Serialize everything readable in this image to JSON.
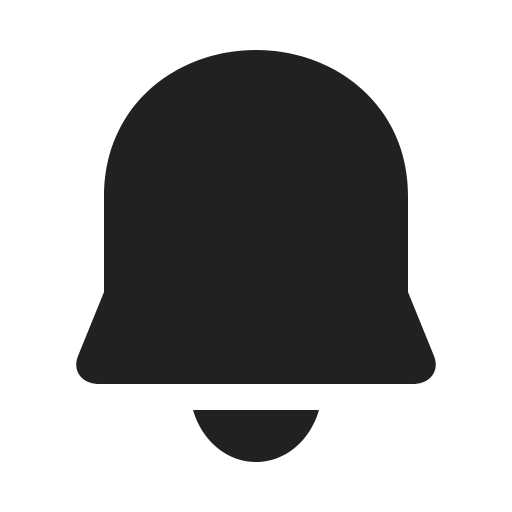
{
  "icon": {
    "name": "bell-icon",
    "color": "#212121",
    "background": "#ffffff"
  }
}
